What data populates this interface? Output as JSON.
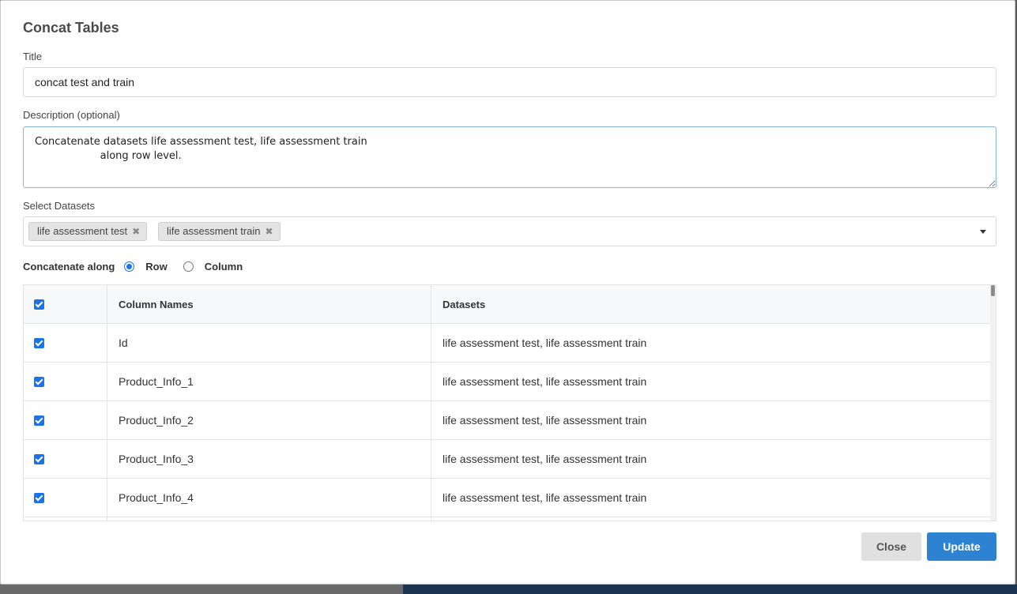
{
  "modal": {
    "title": "Concat Tables",
    "title_label": "Title",
    "title_value": "concat test and train",
    "description_label": "Description (optional)",
    "description_value": "Concatenate datasets life assessment test, life assessment train\n                    along row level.",
    "select_label": "Select Datasets",
    "selected_datasets": [
      "life assessment test",
      "life assessment train"
    ],
    "remove_glyph": "✖",
    "concat_label": "Concatenate along",
    "concat_options": [
      "Row",
      "Column"
    ],
    "concat_selected": "Row"
  },
  "table": {
    "headers": [
      "",
      "Column Names",
      "Datasets"
    ],
    "rows": [
      {
        "checked": true,
        "column": "Id",
        "datasets": "life assessment test, life assessment train"
      },
      {
        "checked": true,
        "column": "Product_Info_1",
        "datasets": "life assessment test, life assessment train"
      },
      {
        "checked": true,
        "column": "Product_Info_2",
        "datasets": "life assessment test, life assessment train"
      },
      {
        "checked": true,
        "column": "Product_Info_3",
        "datasets": "life assessment test, life assessment train"
      },
      {
        "checked": true,
        "column": "Product_Info_4",
        "datasets": "life assessment test, life assessment train"
      }
    ]
  },
  "footer": {
    "close_label": "Close",
    "update_label": "Update"
  },
  "colors": {
    "accent": "#1a73e8",
    "update_button": "#2d83d1",
    "close_button": "#e0e0e0"
  }
}
